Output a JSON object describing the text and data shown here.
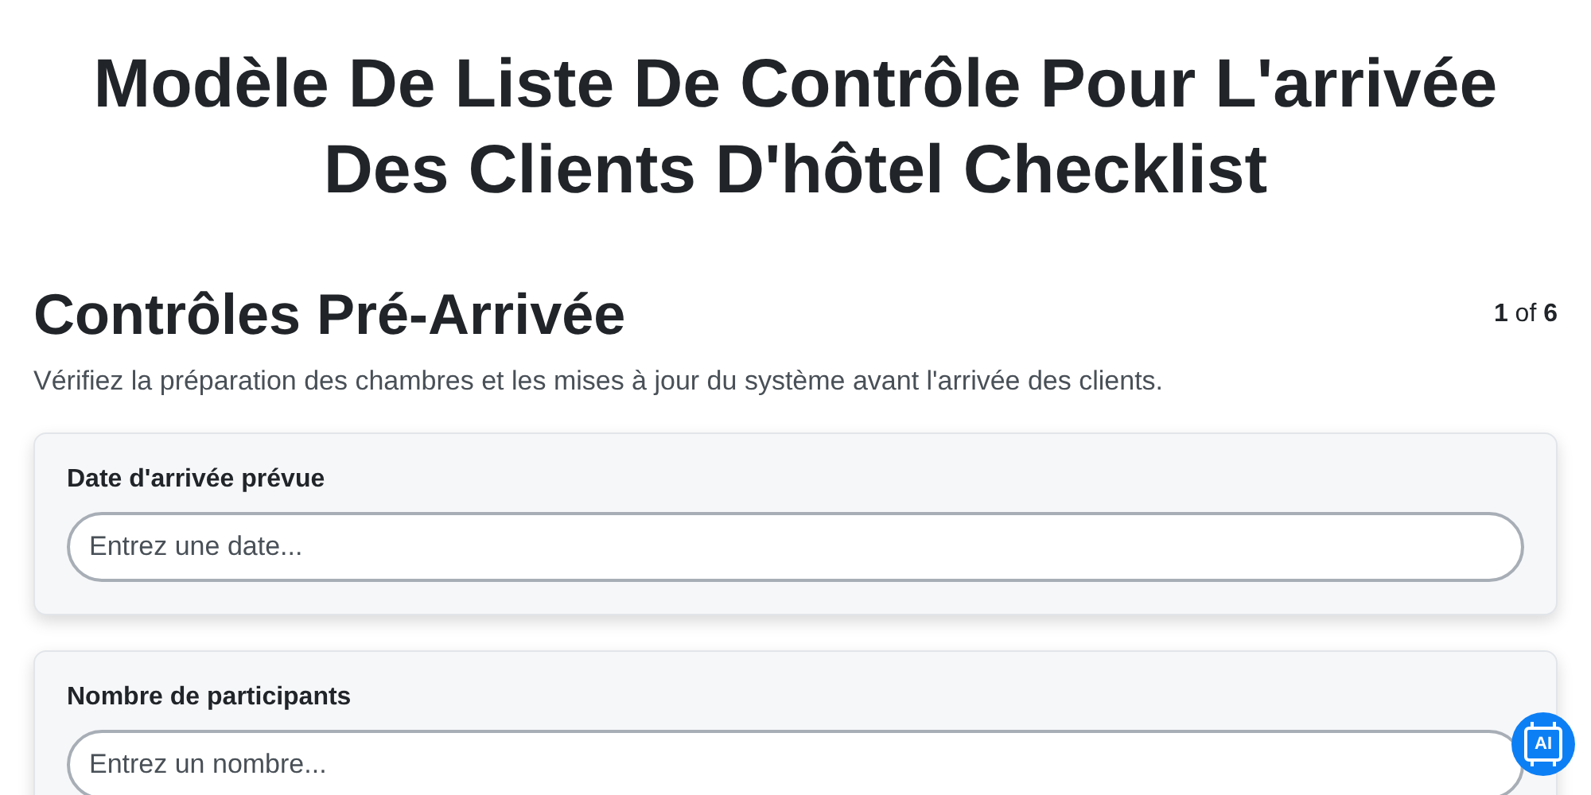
{
  "title": "Modèle De Liste De Contrôle Pour L'arrivée Des Clients D'hôtel Checklist",
  "section": {
    "heading": "Contrôles Pré-Arrivée",
    "pager": "**1** of **6**",
    "description": "Vérifiez la préparation des chambres et les mises à jour du système avant l'arrivée des clients."
  },
  "fields": [
    {
      "label": "Date d'arrivée prévue",
      "placeholder": "Entrez une date..."
    },
    {
      "label": "Nombre de participants",
      "placeholder": "Entrez un nombre..."
    }
  ],
  "ai_button": {
    "label": "AI"
  }
}
